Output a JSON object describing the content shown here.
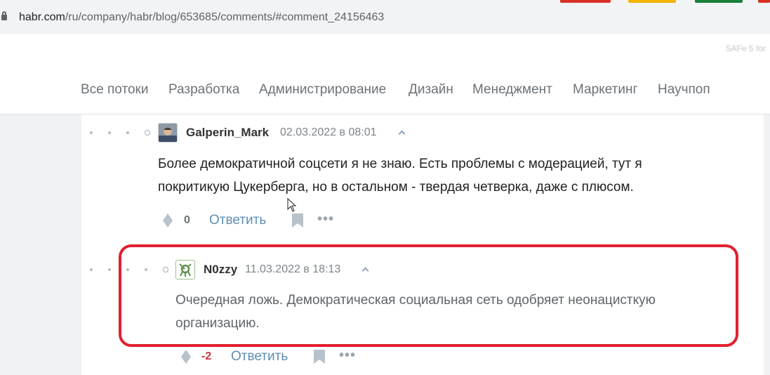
{
  "browser": {
    "url_host": "habr.com",
    "url_path": "/ru/company/habr/blog/653685/comments/#comment_24156463",
    "bookmark_right": "SAFe 5 for",
    "tab_colors": [
      "#d93025",
      "#f4b400",
      "#188038",
      "#d93025"
    ]
  },
  "nav": {
    "items": [
      "Все потоки",
      "Разработка",
      "Администрирование",
      "Дизайн",
      "Менеджмент",
      "Маркетинг",
      "Научпоп"
    ]
  },
  "comments": [
    {
      "user": "Galperin_Mark",
      "date": "02.03.2022 в 08:01",
      "text_line1": "Более демократичной соцсети я не знаю. Есть проблемы с модерацией, тут я",
      "text_line2": "покритикую Цукерберга, но в остальном - твердая четверка, даже с плюсом.",
      "score": "0",
      "score_color": "#6b7277",
      "reply_label": "Ответить"
    },
    {
      "user": "N0zzy",
      "date": "11.03.2022 в 18:13",
      "text_line1": "Очередная ложь. Демократическая социальная сеть одобряет неонацисткую",
      "text_line2": "организацию.",
      "score": "-2",
      "score_color": "#d0323b",
      "reply_label": "Ответить"
    }
  ],
  "colors": {
    "highlight": "#e21f2f",
    "reply_link": "#5e8eb2"
  }
}
